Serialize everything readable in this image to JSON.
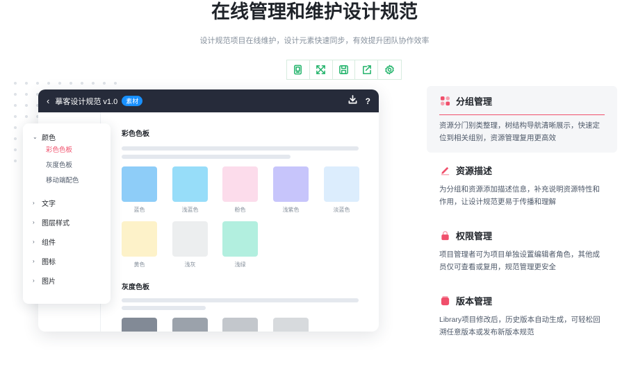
{
  "hero": {
    "title": "在线管理和维护设计规范",
    "subtitle": "设计规范项目在线维护，设计元素快速同步，有效提升团队协作效率"
  },
  "toolbar": {
    "icons": [
      "page-icon",
      "expand-icon",
      "save-icon",
      "share-icon",
      "settings-icon"
    ],
    "accent": "#21b36a"
  },
  "app": {
    "back": "‹",
    "title": "摹客设计规范 v1.0",
    "badge": "素材",
    "help": "?",
    "sidebar": {
      "groups": [
        {
          "label": "颜色",
          "expanded": true,
          "items": [
            "彩色色板",
            "灰度色板",
            "移动端配色"
          ],
          "active_item": "彩色色板"
        },
        {
          "label": "文字",
          "expanded": false
        },
        {
          "label": "图层样式",
          "expanded": false
        },
        {
          "label": "组件",
          "expanded": false
        },
        {
          "label": "图标",
          "expanded": false
        },
        {
          "label": "图片",
          "expanded": false
        }
      ]
    },
    "color_section": {
      "title": "彩色色板",
      "swatches": [
        {
          "label": "蓝色",
          "color": "#8ecdf8"
        },
        {
          "label": "浅蓝色",
          "color": "#97ddf9"
        },
        {
          "label": "粉色",
          "color": "#fcdceb"
        },
        {
          "label": "浅紫色",
          "color": "#c7c5fb"
        },
        {
          "label": "淡蓝色",
          "color": "#dcedfd"
        },
        {
          "label": "黄色",
          "color": "#fdf2c9"
        },
        {
          "label": "浅灰",
          "color": "#eceeef"
        },
        {
          "label": "浅绿",
          "color": "#b2efdf"
        }
      ]
    },
    "gray_section": {
      "title": "灰度色板",
      "swatches": [
        {
          "color": "#828a96"
        },
        {
          "color": "#9ba2ab"
        },
        {
          "color": "#c3c7cc"
        },
        {
          "color": "#d7dadd"
        }
      ]
    }
  },
  "features": [
    {
      "title": "分组管理",
      "desc": "资源分门别类整理，树结构导航清晰展示，快速定位到相关组别，资源管理复用更高效",
      "icon": "group-icon",
      "active": true
    },
    {
      "title": "资源描述",
      "desc": "为分组和资源添加描述信息，补充说明资源特性和作用，让设计规范更易于传播和理解",
      "icon": "pencil-icon",
      "active": false
    },
    {
      "title": "权限管理",
      "desc": "项目管理者可为项目单独设置编辑者角色，其他成员仅可查看或复用，规范管理更安全",
      "icon": "lock-icon",
      "active": false
    },
    {
      "title": "版本管理",
      "desc": "Library项目修改后，历史版本自动生成，可轻松回溯任意版本或发布新版本规范",
      "icon": "version-icon",
      "active": false
    }
  ],
  "colors": {
    "accent_pink": "#f04f6b",
    "header_dark": "#262b3a",
    "badge_blue": "#1890ff"
  }
}
